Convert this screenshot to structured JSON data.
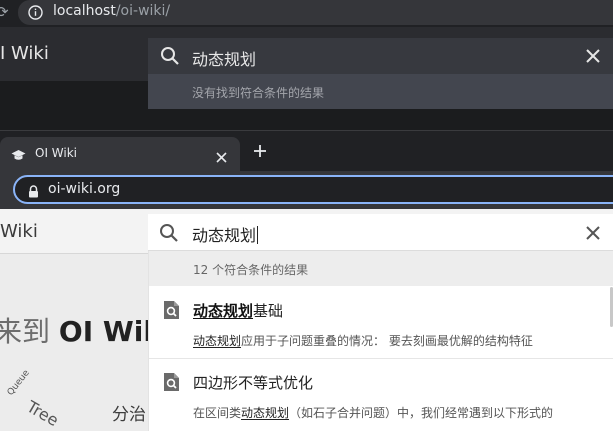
{
  "top_window": {
    "address_bar": {
      "url_host": "localhost",
      "url_path": "/oi-wiki/"
    },
    "header": {
      "site_name": "I Wiki"
    },
    "search": {
      "query": "动态规划",
      "no_results": "没有找到符合条件的结果"
    }
  },
  "bottom_window": {
    "tab": {
      "title": "OI Wiki",
      "new_tab": "+"
    },
    "address_bar": {
      "url": "oi-wiki.org"
    },
    "header": {
      "site_name": "Wiki"
    },
    "hero": {
      "prefix": "来到",
      "brand": "OI Wiki"
    },
    "cloud_words": [
      "Queue",
      "Tree",
      "分治"
    ],
    "search": {
      "query": "动态规划",
      "results_count": "12 个符合条件的结果",
      "results": [
        {
          "title_highlight": "动态规划",
          "title_rest": "基础",
          "snippet_highlight": "动态规划",
          "snippet_rest": "应用于子问题重叠的情况： 要去刻画最优解的结构特征"
        },
        {
          "title": "四边形不等式优化",
          "snippet_before": "在区间类",
          "snippet_highlight": "动态规划",
          "snippet_after": "（如石子合并问题）中，我们经常遇到以下形式的"
        }
      ]
    }
  },
  "colors": {
    "dark_chrome": "#202124",
    "url_focus": "#8ab4f8",
    "dark_search": "#37393f",
    "light_page": "#ececec"
  },
  "icons": [
    "info-icon",
    "search-icon",
    "close-icon",
    "graduation-cap-icon",
    "plus-icon",
    "lock-icon",
    "document-search-icon"
  ]
}
